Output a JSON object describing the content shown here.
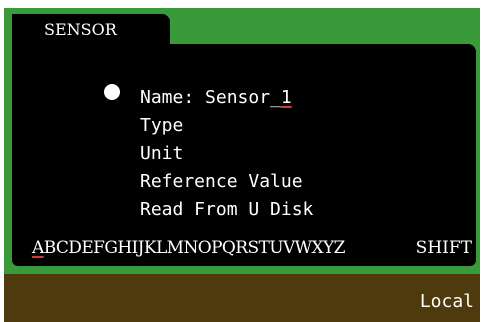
{
  "tab": {
    "label": "SENSOR"
  },
  "menu": {
    "items": [
      {
        "label_prefix": "Name: ",
        "value_main": "Sensor_",
        "value_cursor": "1"
      },
      {
        "label": "Type"
      },
      {
        "label": "Unit"
      },
      {
        "label": "Reference Value"
      },
      {
        "label": "Read From U Disk"
      }
    ],
    "selected_index": 0,
    "selector_icon": "filled-circle-icon"
  },
  "keyboard": {
    "first_letter": "A",
    "rest_letters": "BCDEFGHIJKLMNOPQRSTUVWXYZ",
    "shift_label": "SHIFT"
  },
  "status_bar": {
    "mode": "Local"
  },
  "colors": {
    "frame": "#3a9a3a",
    "panel": "#000000",
    "status_bar": "#4e3a0c",
    "text": "#ffffff",
    "cursor_underline": "#d23a3a"
  }
}
